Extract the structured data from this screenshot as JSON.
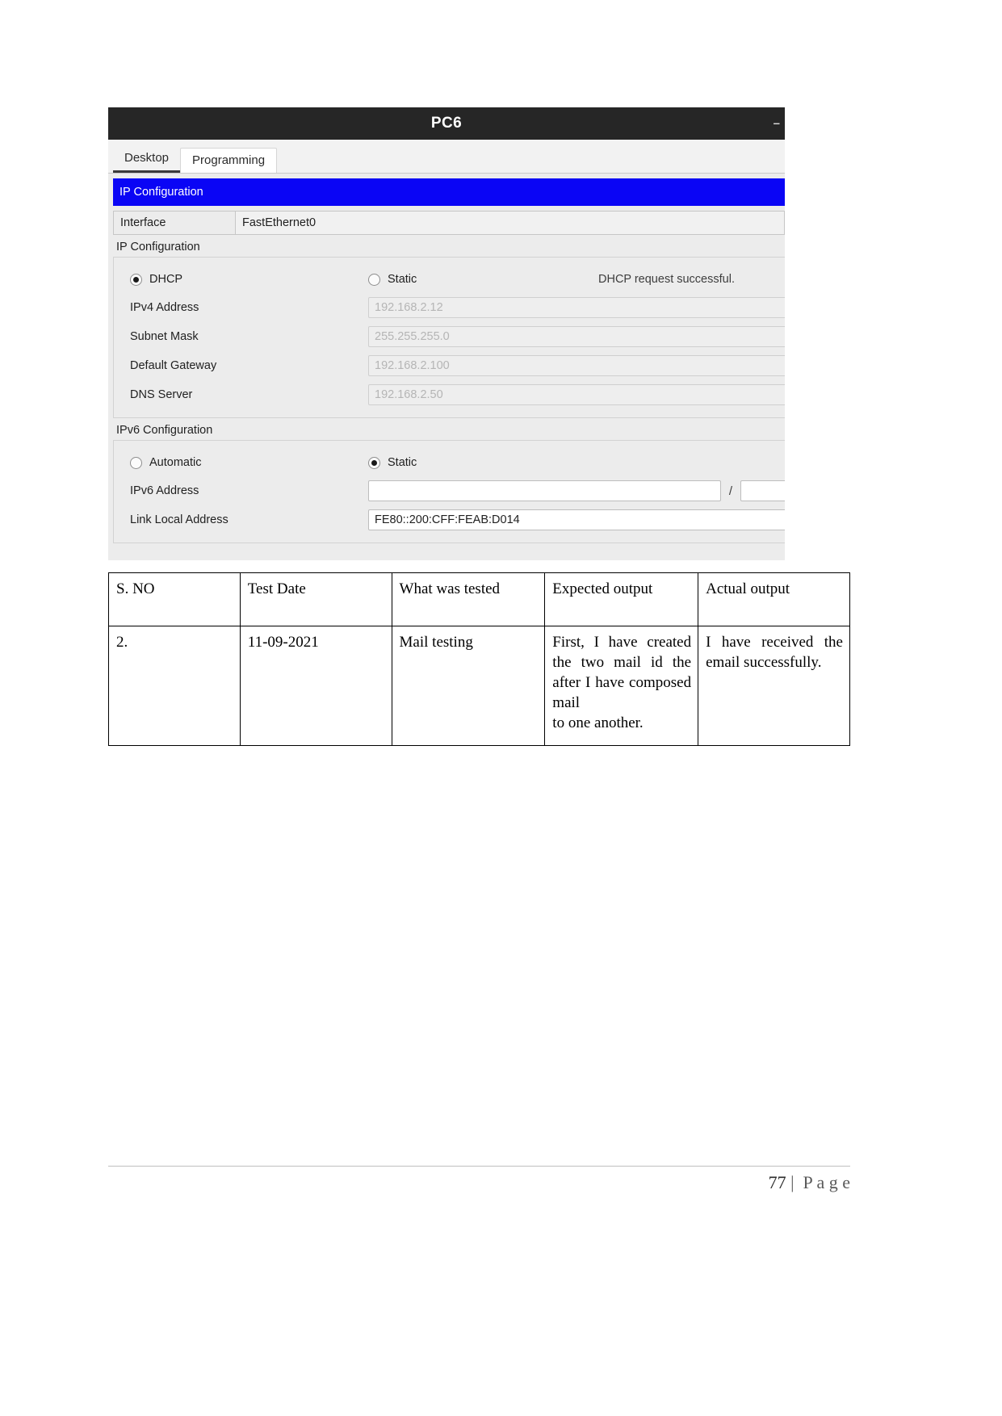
{
  "window": {
    "title": "PC6",
    "window_buttons": "–",
    "tabs": [
      {
        "label": "Desktop",
        "active": true
      },
      {
        "label": "Programming",
        "active": false
      }
    ],
    "banner_title": "IP Configuration",
    "interface": {
      "label": "Interface",
      "value": "FastEthernet0"
    },
    "ipv4": {
      "section_label": "IP Configuration",
      "dhcp_label": "DHCP",
      "static_label": "Static",
      "status": "DHCP request successful.",
      "selected_mode": "DHCP",
      "fields": [
        {
          "label": "IPv4 Address",
          "value": "192.168.2.12"
        },
        {
          "label": "Subnet Mask",
          "value": "255.255.255.0"
        },
        {
          "label": "Default Gateway",
          "value": "192.168.2.100"
        },
        {
          "label": "DNS Server",
          "value": "192.168.2.50"
        }
      ]
    },
    "ipv6": {
      "section_label": "IPv6 Configuration",
      "automatic_label": "Automatic",
      "static_label": "Static",
      "selected_mode": "Static",
      "address_label": "IPv6 Address",
      "address_value": "",
      "prefix_separator": "/",
      "prefix_value": "",
      "link_local_label": "Link Local Address",
      "link_local_value": "FE80::200:CFF:FEAB:D014"
    }
  },
  "test_table": {
    "headers": [
      "S. NO",
      "Test Date",
      "What was tested",
      "Expected output",
      "Actual output"
    ],
    "rows": [
      {
        "sno": "2.",
        "date": "11-09-2021",
        "what": "Mail testing",
        "expected": "First, I have created the two mail id the after I have composed mail\nto one another.",
        "actual": "I have received the email successfully."
      }
    ]
  },
  "footer": {
    "page_number": "77",
    "page_label": " |  P a g e"
  },
  "colors": {
    "banner_blue": "#0a05f5",
    "titlebar_dark": "#262626",
    "panel_gray": "#ececec",
    "input_placeholder": "#b5b5b5"
  }
}
